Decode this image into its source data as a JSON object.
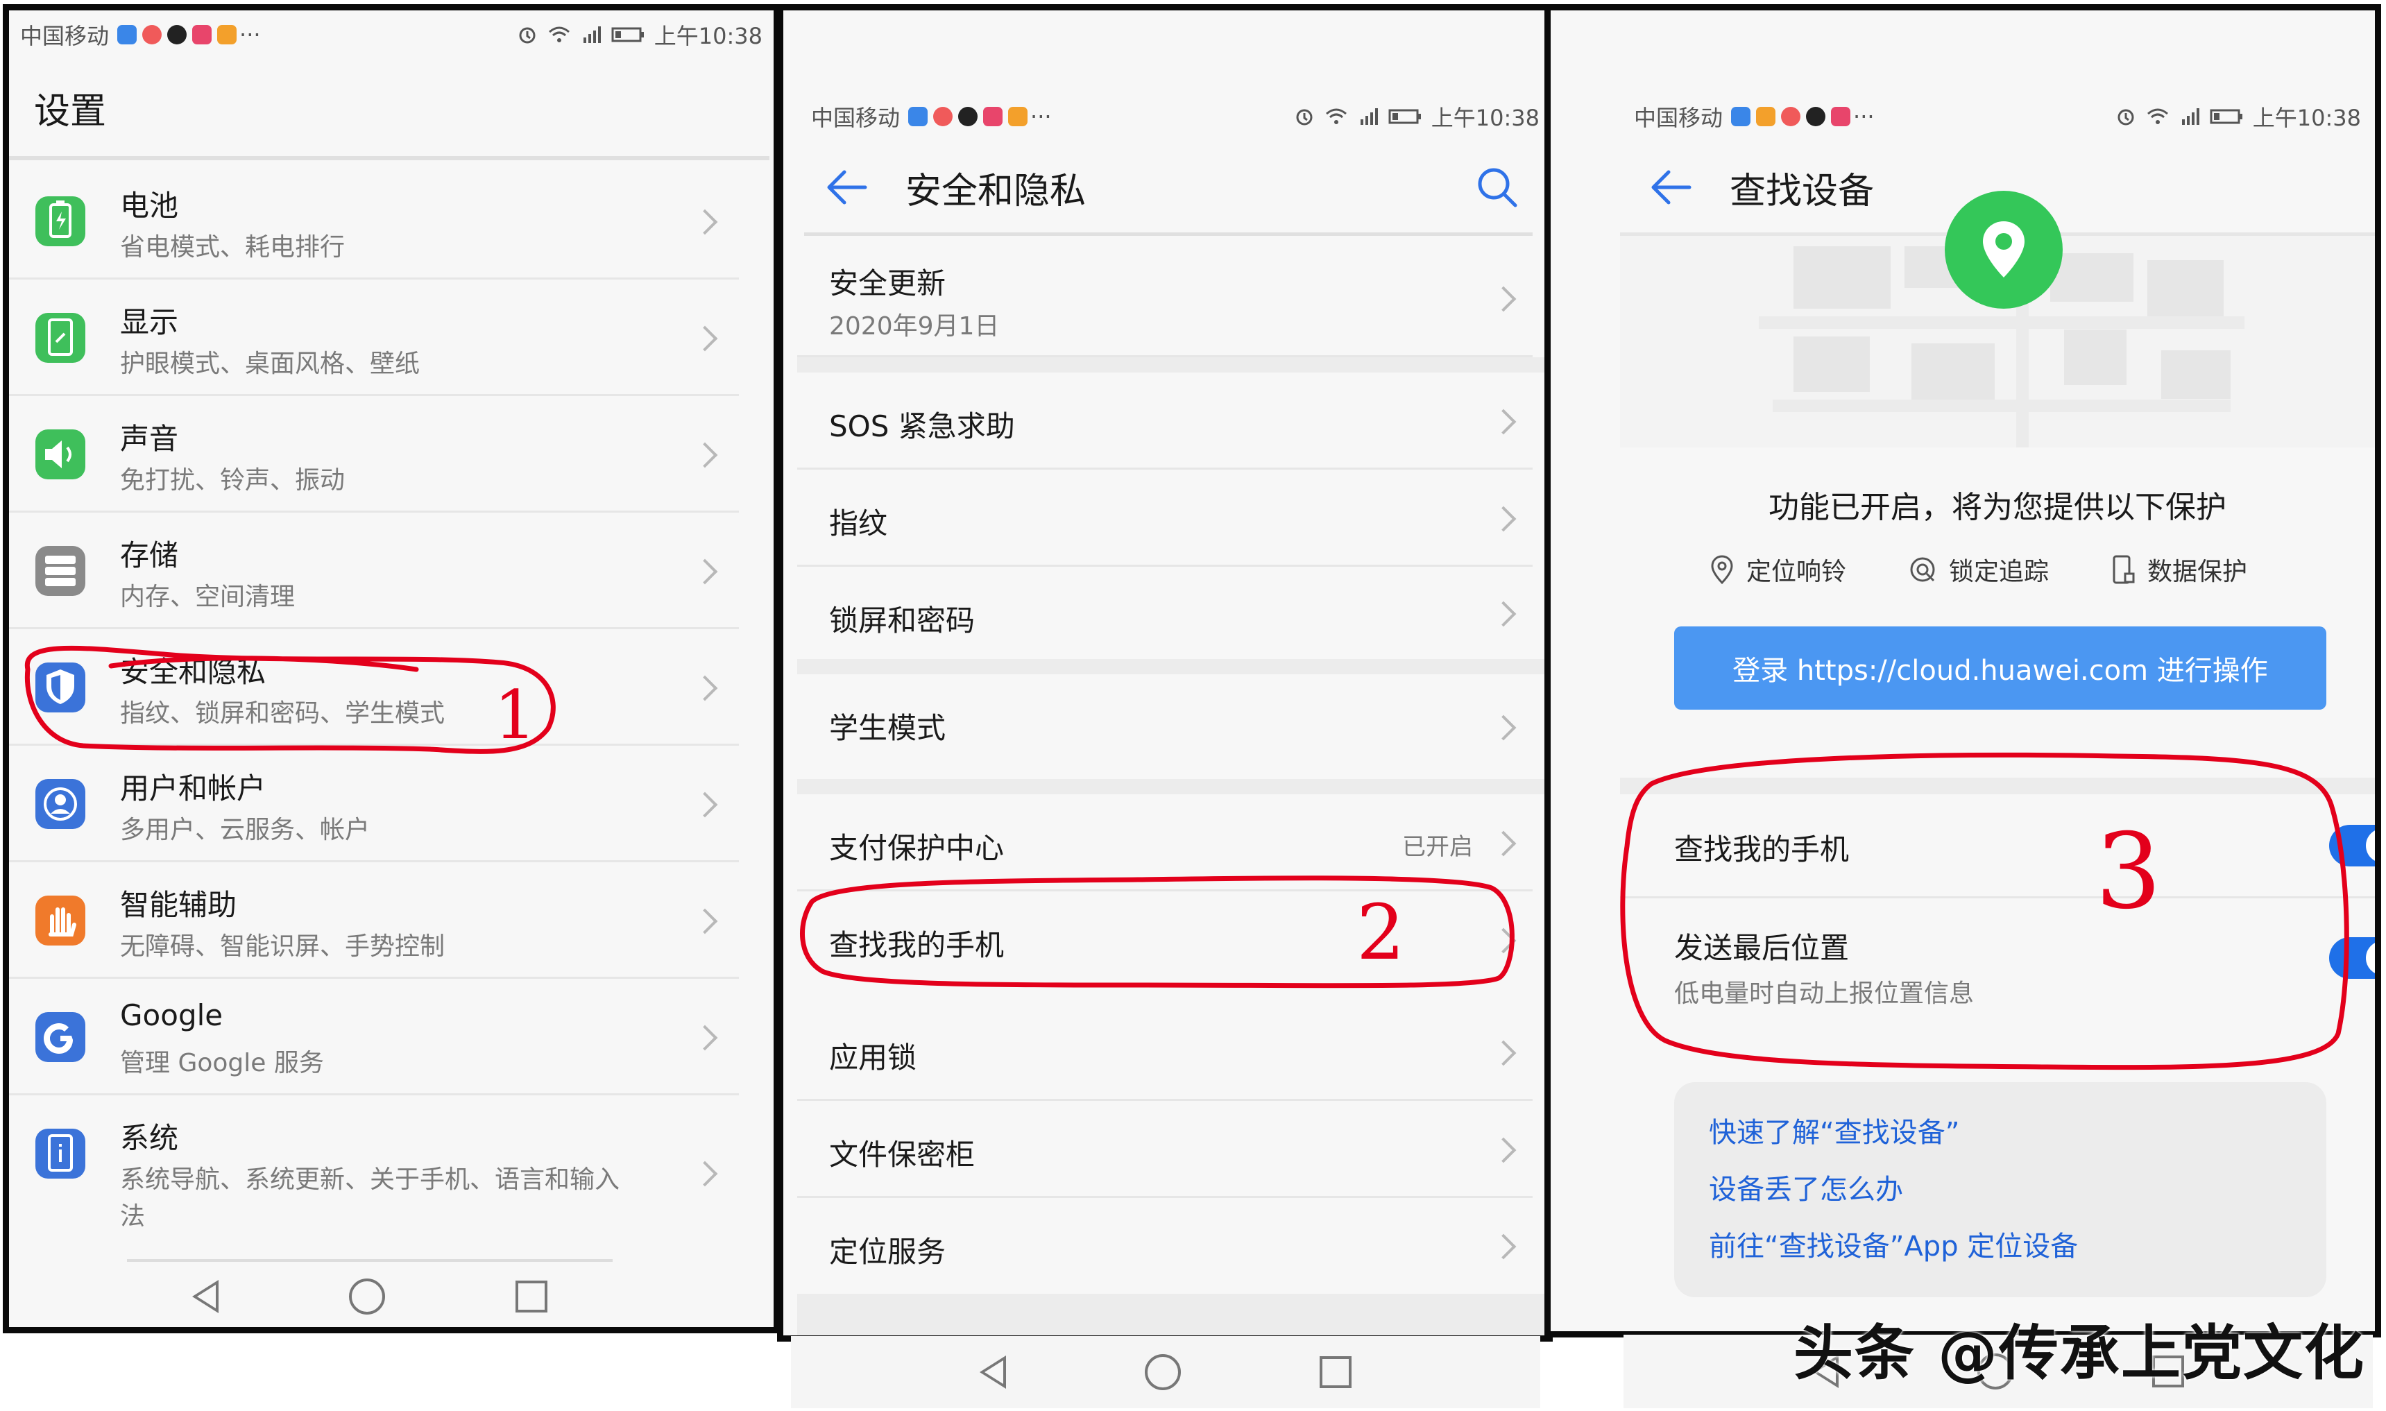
{
  "colors": {
    "accent": "#2f72e8",
    "annotation": "#e3001b",
    "green": "#34c759",
    "toggle": "#1f70e8",
    "button": "#4b97f2",
    "link": "#1f62d8"
  },
  "panel1": {
    "status": {
      "carrier": "中国移动",
      "time": "上午10:38",
      "more": "···"
    },
    "title": "设置",
    "items": [
      {
        "title": "电池",
        "subtitle": "省电模式、耗电排行",
        "icon": "battery-icon",
        "color": "#3fbf5b"
      },
      {
        "title": "显示",
        "subtitle": "护眼模式、桌面风格、壁纸",
        "icon": "display-icon",
        "color": "#3fbf5b"
      },
      {
        "title": "声音",
        "subtitle": "免打扰、铃声、振动",
        "icon": "speaker-icon",
        "color": "#3fbf5b"
      },
      {
        "title": "存储",
        "subtitle": "内存、空间清理",
        "icon": "storage-icon",
        "color": "#8a8a8a"
      },
      {
        "title": "安全和隐私",
        "subtitle": "指纹、锁屏和密码、学生模式",
        "icon": "shield-icon",
        "color": "#3b73d9"
      },
      {
        "title": "用户和帐户",
        "subtitle": "多用户、云服务、帐户",
        "icon": "user-icon",
        "color": "#3b73d9"
      },
      {
        "title": "智能辅助",
        "subtitle": "无障碍、智能识屏、手势控制",
        "icon": "hand-icon",
        "color": "#f07a2b"
      },
      {
        "title": "Google",
        "subtitle": "管理 Google 服务",
        "icon": "google-icon",
        "color": "#3b73d9"
      },
      {
        "title": "系统",
        "subtitle1": "系统导航、系统更新、关于手机、语言和输入",
        "subtitle2": "法",
        "icon": "system-info-icon",
        "color": "#3b73d9"
      }
    ],
    "annotation": "1"
  },
  "panel2": {
    "status": {
      "carrier": "中国移动",
      "time": "上午10:38",
      "more": "···"
    },
    "title": "安全和隐私",
    "security_update": {
      "title": "安全更新",
      "date": "2020年9月1日"
    },
    "items": {
      "sos": "SOS 紧急求助",
      "fingerprint": "指纹",
      "lockscreen": "锁屏和密码",
      "student": "学生模式",
      "payment": "支付保护中心",
      "payment_status": "已开启",
      "findphone": "查找我的手机",
      "applock": "应用锁",
      "filesafe": "文件保密柜",
      "location": "定位服务"
    },
    "annotation": "2"
  },
  "panel3": {
    "status": {
      "carrier": "中国移动",
      "time": "上午10:38",
      "more": "···"
    },
    "title": "查找设备",
    "headline": "功能已开启，将为您提供以下保护",
    "features": [
      "定位响铃",
      "锁定追踪",
      "数据保护"
    ],
    "login_button": "登录 https://cloud.huawei.com 进行操作",
    "find_my_phone": {
      "label": "查找我的手机",
      "enabled": true
    },
    "send_last_location": {
      "label": "发送最后位置",
      "desc": "低电量时自动上报位置信息",
      "enabled": true
    },
    "links": [
      "快速了解“查找设备”",
      "设备丢了怎么办",
      "前往“查找设备”App 定位设备"
    ],
    "annotation": "3"
  },
  "watermark": "头条 @传承上党文化"
}
